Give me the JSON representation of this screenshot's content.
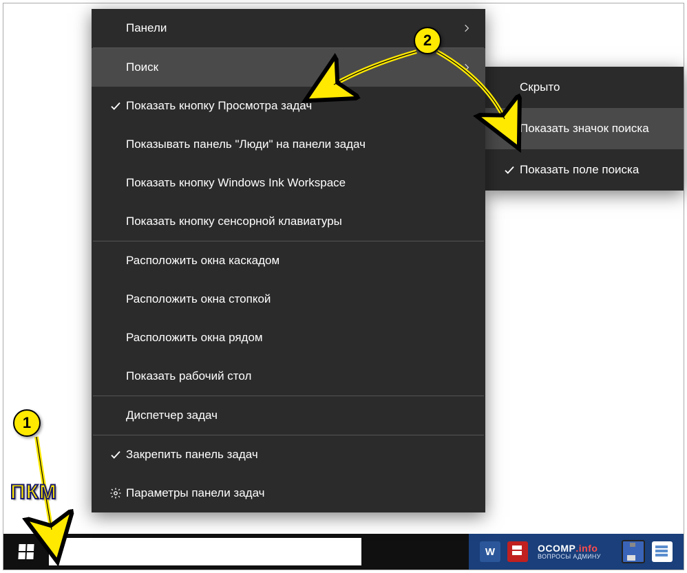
{
  "taskbar": {
    "search_placeholder": "",
    "logo_line1_pre": "OCOMP",
    "logo_line1_suf": ".info",
    "logo_line2": "ВОПРОСЫ АДМИНУ"
  },
  "menu": {
    "panels": "Панели",
    "search": "Поиск",
    "show_taskview": "Показать кнопку Просмотра задач",
    "show_people": "Показывать панель \"Люди\" на панели задач",
    "show_ink": "Показать кнопку Windows Ink Workspace",
    "show_touchkb": "Показать кнопку сенсорной клавиатуры",
    "cascade": "Расположить окна каскадом",
    "stacked": "Расположить окна стопкой",
    "sidebyside": "Расположить окна рядом",
    "show_desktop": "Показать рабочий стол",
    "task_manager": "Диспетчер задач",
    "lock_taskbar": "Закрепить панель задач",
    "taskbar_settings": "Параметры панели задач"
  },
  "submenu": {
    "hidden": "Скрыто",
    "show_icon": "Показать значок поиска",
    "show_box": "Показать поле поиска"
  },
  "annotations": {
    "callout_1": "1",
    "callout_2": "2",
    "pkm": "ПКМ"
  }
}
